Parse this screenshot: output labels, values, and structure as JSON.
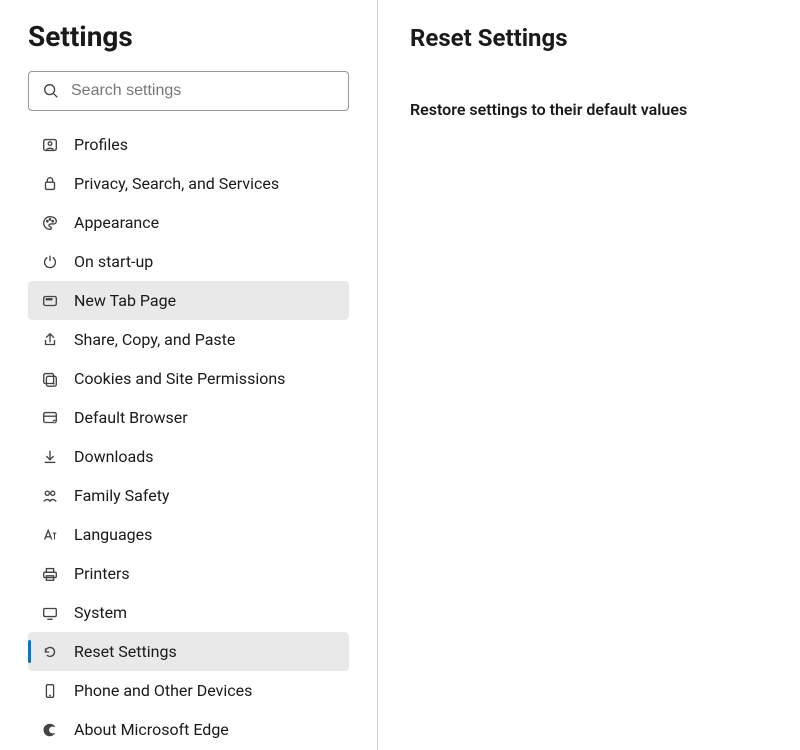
{
  "sidebar": {
    "title": "Settings",
    "search_placeholder": "Search settings",
    "items": [
      {
        "label": "Profiles",
        "icon": "profile-icon"
      },
      {
        "label": "Privacy, Search, and Services",
        "icon": "lock-icon"
      },
      {
        "label": "Appearance",
        "icon": "palette-icon"
      },
      {
        "label": "On start-up",
        "icon": "power-icon"
      },
      {
        "label": "New Tab Page",
        "icon": "newtab-icon"
      },
      {
        "label": "Share, Copy, and Paste",
        "icon": "share-icon"
      },
      {
        "label": "Cookies and Site Permissions",
        "icon": "cookies-icon"
      },
      {
        "label": "Default Browser",
        "icon": "browser-icon"
      },
      {
        "label": "Downloads",
        "icon": "download-icon"
      },
      {
        "label": "Family Safety",
        "icon": "family-icon"
      },
      {
        "label": "Languages",
        "icon": "language-icon"
      },
      {
        "label": "Printers",
        "icon": "printer-icon"
      },
      {
        "label": "System",
        "icon": "system-icon"
      },
      {
        "label": "Reset Settings",
        "icon": "reset-icon"
      },
      {
        "label": "Phone and Other Devices",
        "icon": "phone-icon"
      },
      {
        "label": "About Microsoft Edge",
        "icon": "edge-icon"
      }
    ]
  },
  "main": {
    "title": "Reset Settings",
    "setting_label": "Restore settings to their default values"
  }
}
